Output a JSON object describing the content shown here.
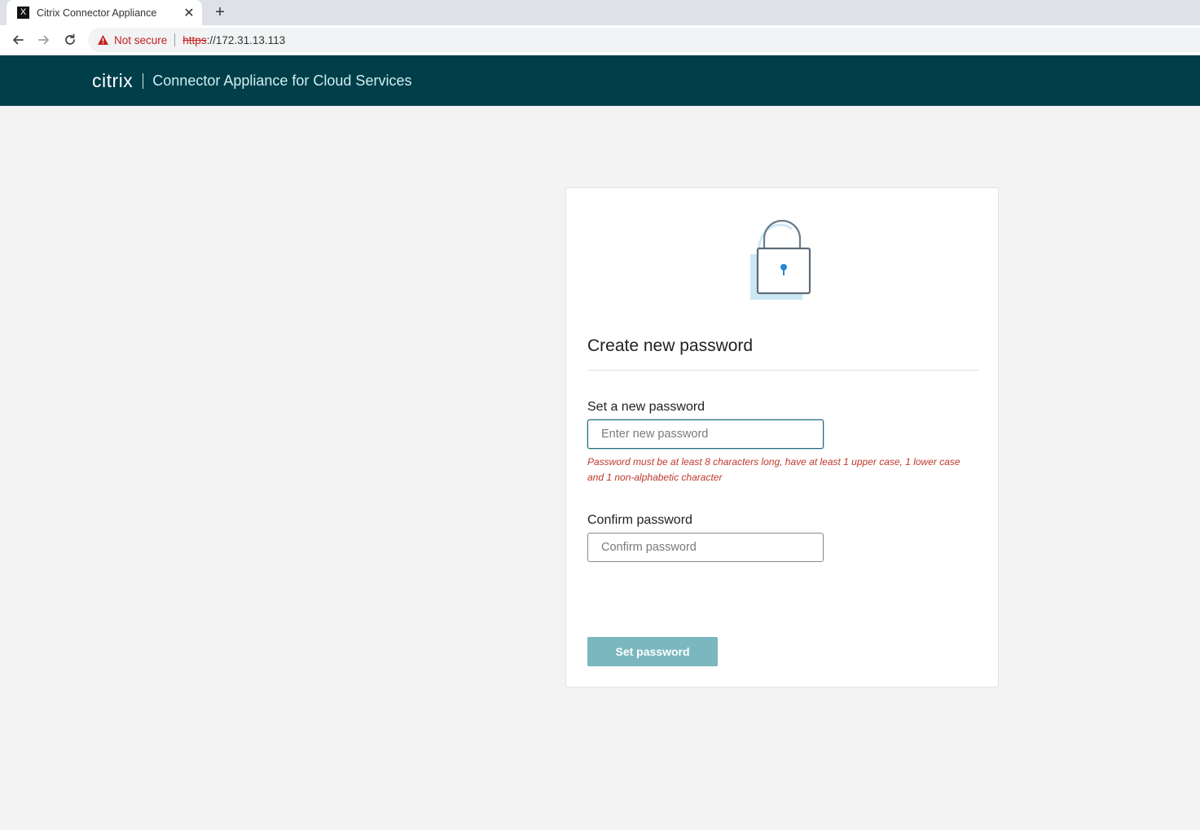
{
  "browser": {
    "tab_title": "Citrix Connector Appliance",
    "tab_favicon_glyph": "X",
    "security_label": "Not secure",
    "url_scheme": "https",
    "url_rest": "://172.31.13.113"
  },
  "header": {
    "logo_text": "citrix",
    "product_name": "Connector Appliance for Cloud Services",
    "background_color": "#003e4a"
  },
  "card": {
    "title": "Create new password",
    "new_password": {
      "label": "Set a new password",
      "placeholder": "Enter new password",
      "value": ""
    },
    "error_message": "Password must be at least 8 characters long, have at least 1 upper case, 1 lower case and 1 non-alphabetic character",
    "confirm_password": {
      "label": "Confirm password",
      "placeholder": "Confirm password",
      "value": ""
    },
    "submit_label": "Set password",
    "submit_color": "#7ab7bf",
    "error_color": "#c0392b"
  }
}
